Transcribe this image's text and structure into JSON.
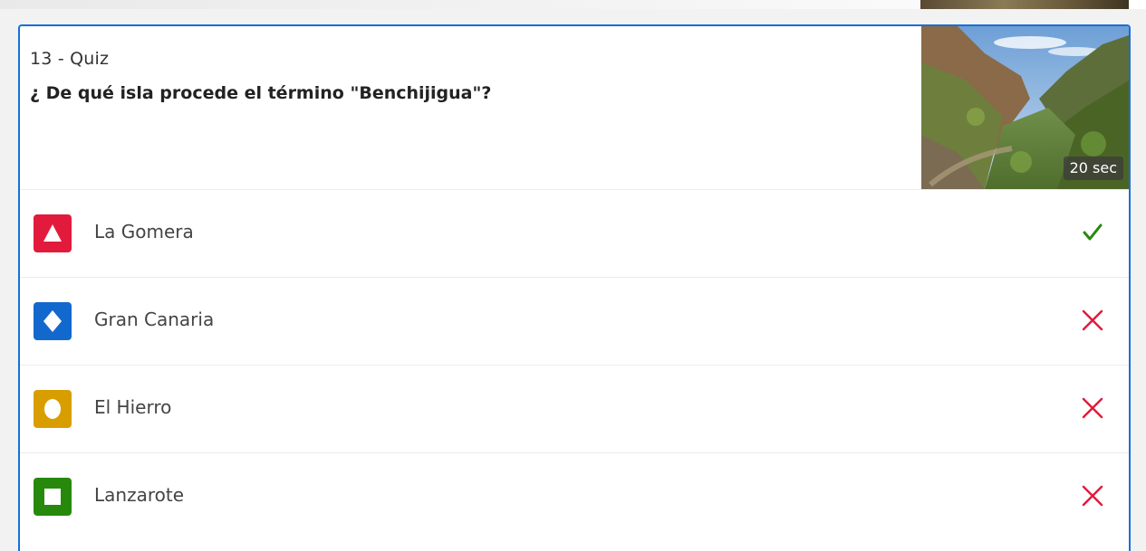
{
  "quiz": {
    "meta": "13 - Quiz",
    "question": "¿ De qué isla procede el término \"Benchijigua\"?",
    "time_limit": "20 sec"
  },
  "answers": [
    {
      "label": "La Gomera",
      "shape": "triangle-icon",
      "color": "#e21b3c",
      "correct": true
    },
    {
      "label": "Gran Canaria",
      "shape": "diamond-icon",
      "color": "#1368ce",
      "correct": false
    },
    {
      "label": "El Hierro",
      "shape": "circle-icon",
      "color": "#d89e00",
      "correct": false
    },
    {
      "label": "Lanzarote",
      "shape": "square-icon",
      "color": "#26890c",
      "correct": false
    }
  ],
  "colors": {
    "accent": "#1a6ed8",
    "correct": "#26890c",
    "incorrect": "#e21b3c"
  }
}
